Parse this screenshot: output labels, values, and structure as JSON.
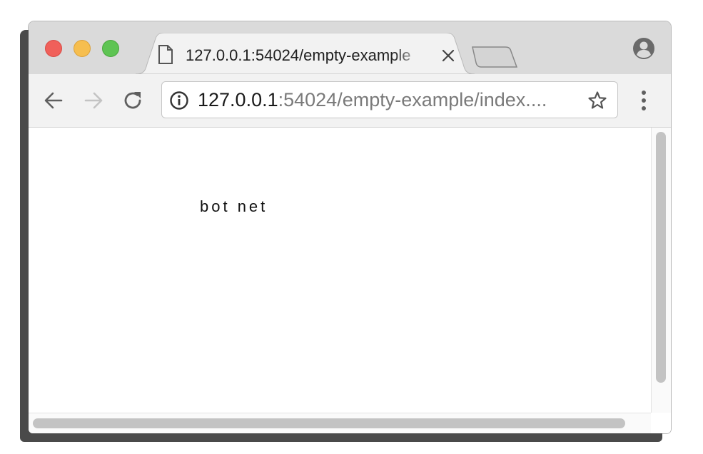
{
  "tab": {
    "title": "127.0.0.1:54024/empty-example"
  },
  "omnibox": {
    "url_host": "127.0.0.1",
    "url_rest": ":54024/empty-example/index...."
  },
  "page": {
    "text": "bot net"
  },
  "icons": {
    "back": "arrow-left",
    "forward": "arrow-right",
    "reload": "reload",
    "info": "info-circle",
    "bookmark": "star-outline",
    "menu": "vertical-dots",
    "profile": "user-avatar",
    "page": "document",
    "close": "x"
  },
  "colors": {
    "close_light": "#f0605a",
    "minimize_light": "#f6be4f",
    "maximize_light": "#5ec453",
    "titlebar": "#dadada",
    "toolbar": "#f2f2f2",
    "url_host": "#1a1a1a",
    "url_rest": "#7a7a7a"
  }
}
